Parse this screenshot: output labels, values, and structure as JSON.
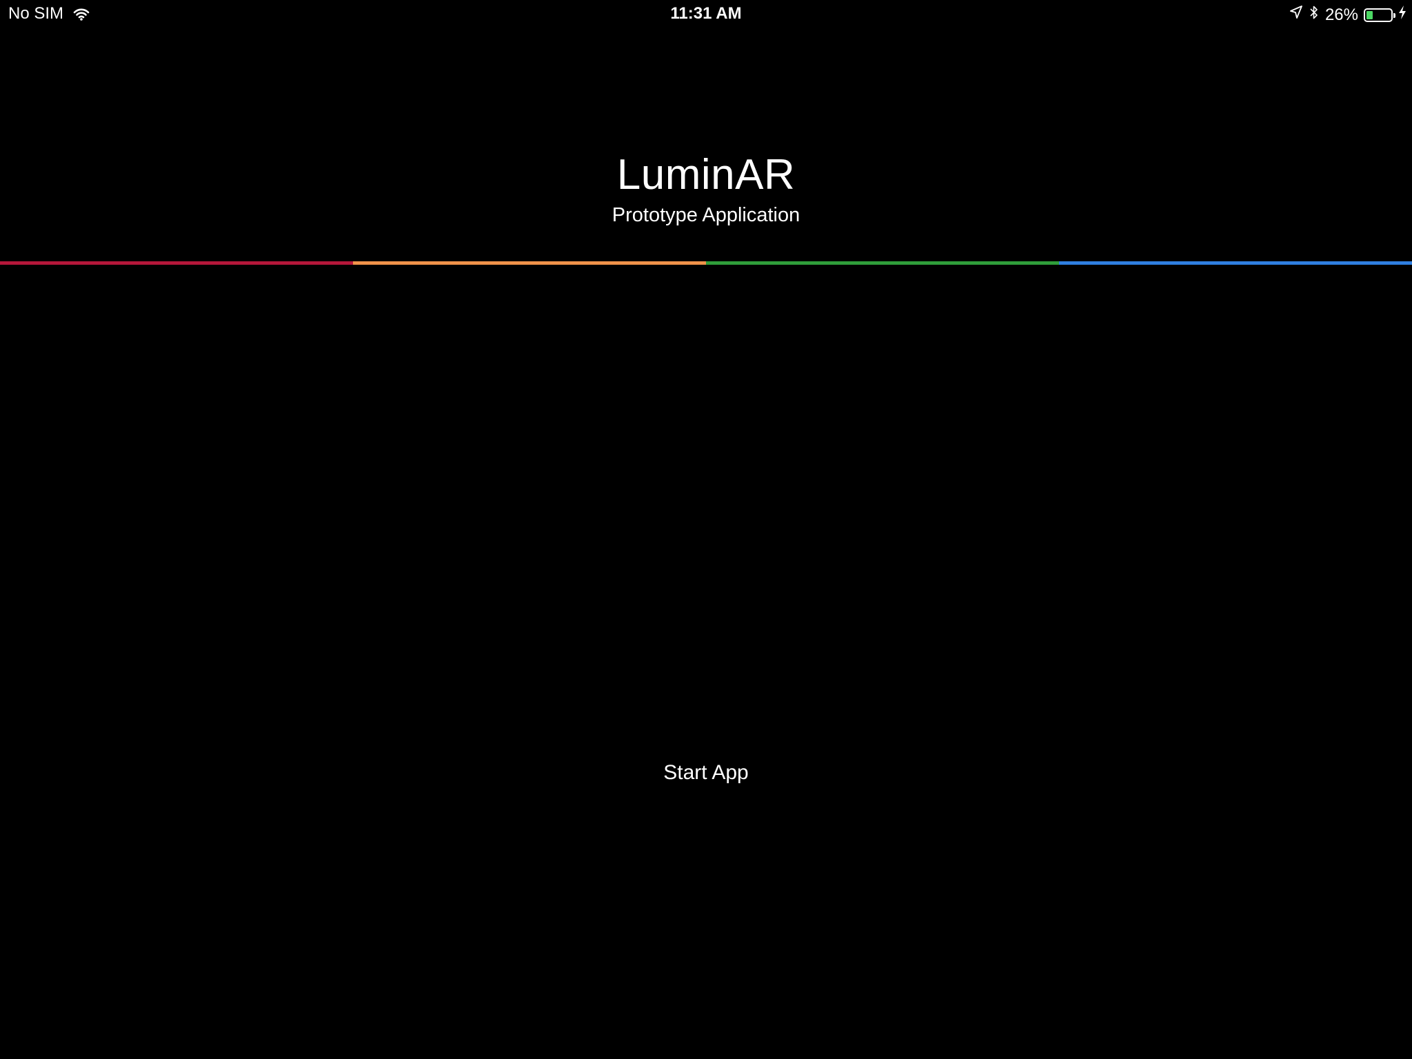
{
  "status_bar": {
    "carrier": "No SIM",
    "time": "11:31 AM",
    "battery_percent": "26%",
    "battery_level": 0.26,
    "icons": [
      "wifi-icon",
      "location-arrow-icon",
      "bluetooth-icon",
      "battery-icon",
      "charging-bolt-icon"
    ]
  },
  "header": {
    "title": "LuminAR",
    "subtitle": "Prototype Application"
  },
  "divider": {
    "colors": [
      "#b5173a",
      "#f0924a",
      "#2f9e3a",
      "#2f7fe0"
    ]
  },
  "main": {
    "start_button_label": "Start App"
  },
  "colors": {
    "background": "#000000",
    "text": "#ffffff",
    "battery_fill": "#4cd964"
  }
}
